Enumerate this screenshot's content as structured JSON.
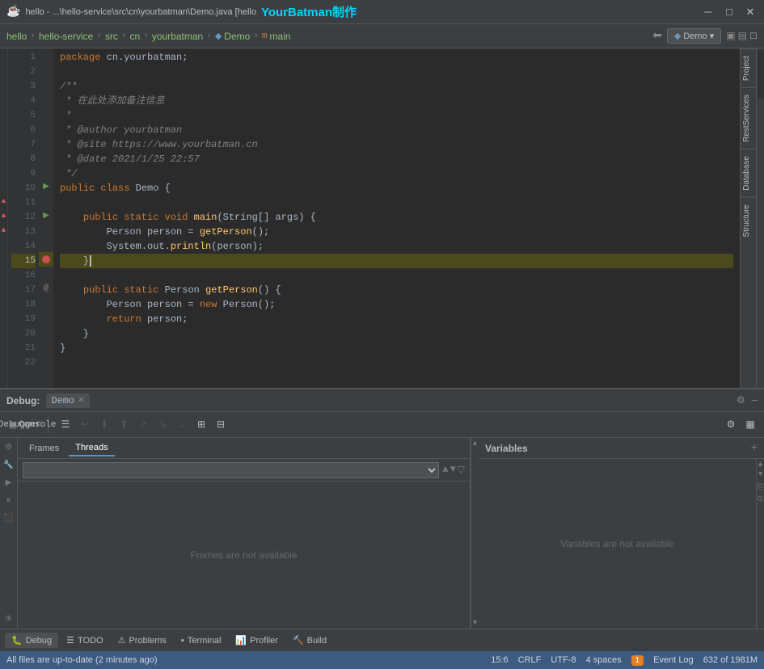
{
  "titleBar": {
    "text": "hello - ...\\hello-service\\src\\cn\\yourbatman\\Demo.java [hello",
    "brand": "YourBatman制作",
    "minBtn": "─",
    "maxBtn": "□",
    "closeBtn": "✕"
  },
  "navBar": {
    "items": [
      "hello",
      "hello-service",
      "src",
      "cn",
      "yourbatman",
      "Demo",
      "main"
    ],
    "demoBtn": "Demo ▾",
    "backwardBtn": "◀",
    "forwardBtn": "▷"
  },
  "editor": {
    "scrollInfo": "▲ 3",
    "lines": [
      {
        "num": "1",
        "gutter": "",
        "code": "package cn.yourbatman;"
      },
      {
        "num": "2",
        "gutter": "",
        "code": ""
      },
      {
        "num": "3",
        "gutter": "",
        "code": "/**"
      },
      {
        "num": "4",
        "gutter": "",
        "code": " * 在此处添加备注信息"
      },
      {
        "num": "5",
        "gutter": "",
        "code": " *"
      },
      {
        "num": "6",
        "gutter": "",
        "code": " * @author yourbatman"
      },
      {
        "num": "7",
        "gutter": "",
        "code": " * @site https://www.yourbatman.cn"
      },
      {
        "num": "8",
        "gutter": "",
        "code": " * @date 2021/1/25 22:57"
      },
      {
        "num": "9",
        "gutter": "",
        "code": " */"
      },
      {
        "num": "10",
        "gutter": "▶",
        "code": "public class Demo {"
      },
      {
        "num": "11",
        "gutter": "",
        "code": ""
      },
      {
        "num": "12",
        "gutter": "▶",
        "code": "    public static void main(String[] args) {"
      },
      {
        "num": "13",
        "gutter": "",
        "code": "        Person person = getPerson();"
      },
      {
        "num": "14",
        "gutter": "",
        "code": "        System.out.println(person);"
      },
      {
        "num": "15",
        "gutter": "●",
        "code": "    }"
      },
      {
        "num": "16",
        "gutter": "",
        "code": ""
      },
      {
        "num": "17",
        "gutter": "@",
        "code": "    public static Person getPerson() {"
      },
      {
        "num": "18",
        "gutter": "",
        "code": "        Person person = new Person();"
      },
      {
        "num": "19",
        "gutter": "",
        "code": "        return person;"
      },
      {
        "num": "20",
        "gutter": "",
        "code": "    }"
      },
      {
        "num": "21",
        "gutter": "",
        "code": "}"
      },
      {
        "num": "22",
        "gutter": "",
        "code": ""
      }
    ]
  },
  "rightSidebar": {
    "tabs": [
      "Project",
      "RestServices",
      "Database",
      "Structure"
    ]
  },
  "debugPanel": {
    "title": "Debug:",
    "sessionTab": "Demo",
    "closeBtn": "✕",
    "settingsBtn": "⚙",
    "minimizeBtn": "─",
    "toolbar": {
      "buttons": [
        {
          "name": "rerun",
          "icon": "↩"
        },
        {
          "name": "stop",
          "icon": "■"
        },
        {
          "name": "resume",
          "icon": "▶"
        },
        {
          "name": "pause",
          "icon": "⏸"
        },
        {
          "name": "step-over",
          "icon": "↷"
        },
        {
          "name": "step-into",
          "icon": "↓"
        },
        {
          "name": "step-out",
          "icon": "↑"
        },
        {
          "name": "run-to-cursor",
          "icon": "→|"
        },
        {
          "name": "evaluate",
          "icon": "⊞"
        },
        {
          "name": "watch",
          "icon": "⊟"
        },
        {
          "name": "settings2",
          "icon": "⚙"
        }
      ]
    },
    "tabs": {
      "debugger": "Debugger",
      "console": "Console"
    },
    "frames": {
      "tabs": [
        "Frames",
        "Threads"
      ],
      "activeTab": "Threads",
      "threadSelectPlaceholder": "",
      "emptyMessage": "Frames are not available"
    },
    "variables": {
      "title": "Variables",
      "emptyMessage": "Variables are not available",
      "addBtn": "+"
    }
  },
  "bottomBar": {
    "tabs": [
      {
        "icon": "🐛",
        "label": "Debug",
        "active": true
      },
      {
        "icon": "≡",
        "label": "TODO",
        "active": false
      },
      {
        "icon": "⚠",
        "label": "Problems",
        "active": false
      },
      {
        "icon": "▪",
        "label": "Terminal",
        "active": false
      },
      {
        "icon": "📊",
        "label": "Profiler",
        "active": false
      },
      {
        "icon": "🔨",
        "label": "Build",
        "active": false
      }
    ]
  },
  "statusBar": {
    "message": "All files are up-to-date (2 minutes ago)",
    "position": "15:6",
    "lineEnding": "CRLF",
    "encoding": "UTF-8",
    "indent": "4 spaces",
    "eventLog": "1",
    "eventLogLabel": "Event Log",
    "memoryUsage": "632 of 1981M"
  }
}
